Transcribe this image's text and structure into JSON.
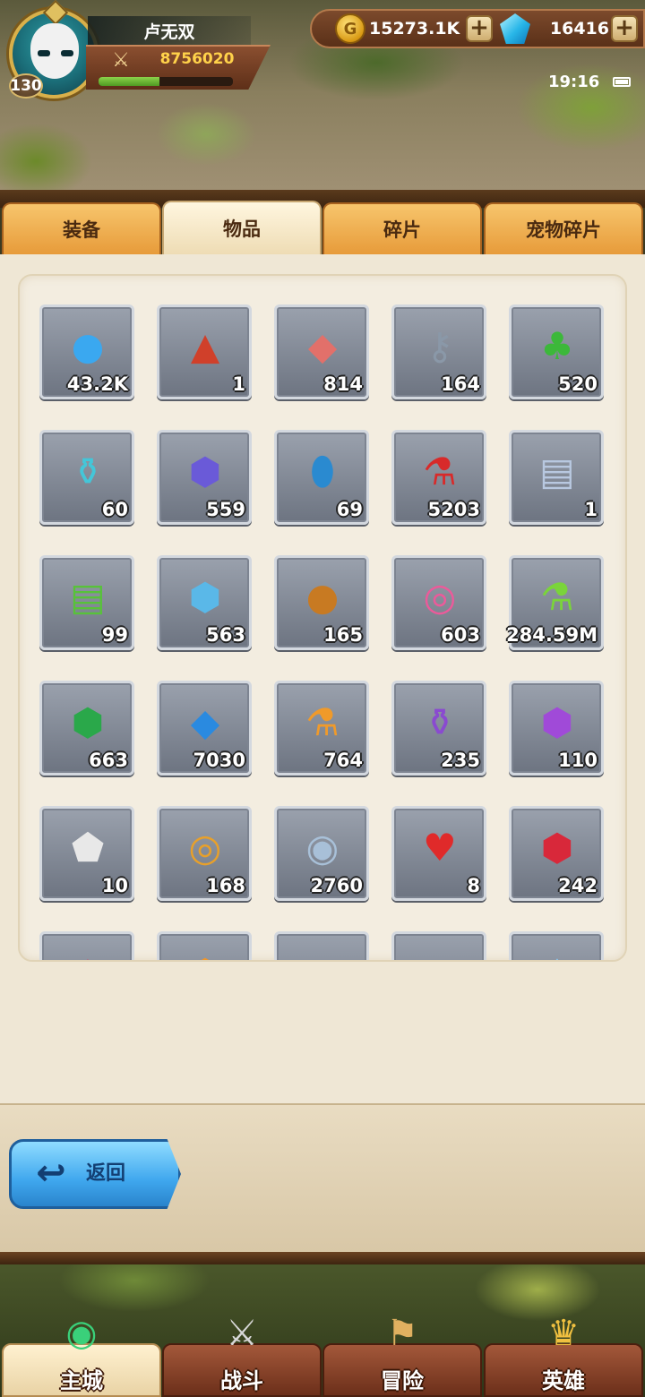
{
  "player": {
    "name": "卢无双",
    "level": "130",
    "power": "8756020",
    "exp_fraction": 0.45
  },
  "currency": {
    "gold": "15273.1K",
    "gems": "16416",
    "plus": "+"
  },
  "status": {
    "time": "19:16"
  },
  "tabs": [
    {
      "label": "装备",
      "active": false
    },
    {
      "label": "物品",
      "active": true
    },
    {
      "label": "碎片",
      "active": false
    },
    {
      "label": "宠物碎片",
      "active": false
    }
  ],
  "items": [
    {
      "icon": "blue-orb-icon",
      "qty": "43.2K",
      "color": "#3aa8f0"
    },
    {
      "icon": "rank-emblem-icon",
      "qty": "1",
      "color": "#d0402a"
    },
    {
      "icon": "meat-icon",
      "qty": "814",
      "color": "#e2706a"
    },
    {
      "icon": "key-icon",
      "qty": "164",
      "color": "#8a98a8"
    },
    {
      "icon": "clover-icon",
      "qty": "520",
      "color": "#3cb83a"
    },
    {
      "icon": "magic-lamp-icon",
      "qty": "60",
      "color": "#44c6d8"
    },
    {
      "icon": "boot-gem-icon",
      "qty": "559",
      "color": "#6a5ad8"
    },
    {
      "icon": "blue-egg-icon",
      "qty": "69",
      "color": "#2a8ad0"
    },
    {
      "icon": "red-potion-icon",
      "qty": "5203",
      "color": "#d82a2a"
    },
    {
      "icon": "helmet-scroll-icon",
      "qty": "1",
      "color": "#b8c8e0"
    },
    {
      "icon": "green-scroll-icon",
      "qty": "99",
      "color": "#58c23a"
    },
    {
      "icon": "shield-gem-icon",
      "qty": "563",
      "color": "#5ab8e8"
    },
    {
      "icon": "sword-coin-icon",
      "qty": "165",
      "color": "#c87a22"
    },
    {
      "icon": "lollipop-pink-icon",
      "qty": "603",
      "color": "#ec5a9a"
    },
    {
      "icon": "green-potion-icon",
      "qty": "284.59M",
      "color": "#7ad43a"
    },
    {
      "icon": "glove-gem-icon",
      "qty": "663",
      "color": "#2aa84a"
    },
    {
      "icon": "blue-crystal-icon",
      "qty": "7030",
      "color": "#2a8ae0"
    },
    {
      "icon": "orange-vial-icon",
      "qty": "764",
      "color": "#f09a2a"
    },
    {
      "icon": "purple-jar-icon",
      "qty": "235",
      "color": "#8a4ad0"
    },
    {
      "icon": "helmet-gem-icon",
      "qty": "110",
      "color": "#a04ad8"
    },
    {
      "icon": "dice-icon",
      "qty": "10",
      "color": "#e8e8e8"
    },
    {
      "icon": "lollipop-rainbow-icon",
      "qty": "168",
      "color": "#e8a02a"
    },
    {
      "icon": "triangle-coin-icon",
      "qty": "2760",
      "color": "#a8c0d8"
    },
    {
      "icon": "heart-icon",
      "qty": "8",
      "color": "#e02a2a"
    },
    {
      "icon": "sword-gem-icon",
      "qty": "242",
      "color": "#d8283a"
    },
    {
      "icon": "red-star-icon",
      "qty": "",
      "color": "#e83a5a"
    },
    {
      "icon": "orange-gem-icon",
      "qty": "",
      "color": "#f0962a"
    },
    {
      "icon": "triangle-badge-icon",
      "qty": "",
      "color": "#f0c040"
    },
    {
      "icon": "gold-item-icon",
      "qty": "",
      "color": "#f0c840"
    },
    {
      "icon": "blue-drop-icon",
      "qty": "",
      "color": "#8ac8f0"
    }
  ],
  "back_button": {
    "label": "返回"
  },
  "nav": [
    {
      "label": "主城",
      "icon": "city-emblem-icon",
      "active": true
    },
    {
      "label": "战斗",
      "icon": "crossed-swords-icon",
      "active": false
    },
    {
      "label": "冒险",
      "icon": "adventure-map-icon",
      "active": false
    },
    {
      "label": "英雄",
      "icon": "hero-crest-icon",
      "active": false
    }
  ]
}
